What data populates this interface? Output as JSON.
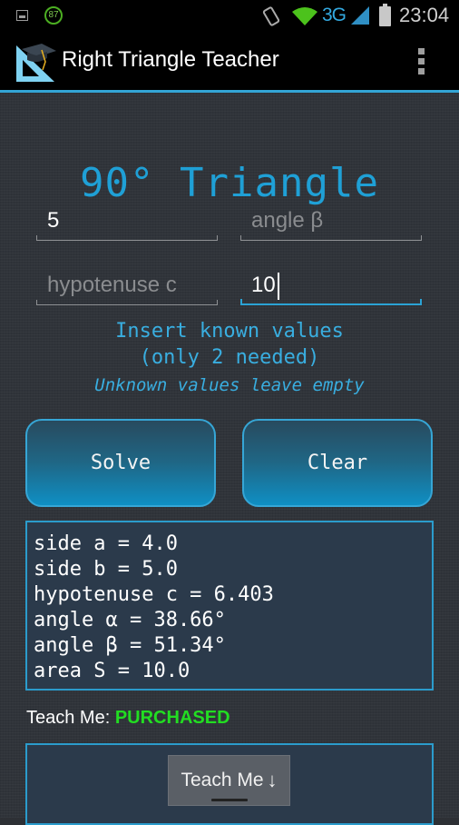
{
  "status_bar": {
    "battery_percent_badge": "87",
    "network": "3G",
    "time": "23:04",
    "icons": [
      "image-notification-icon",
      "battery-percent-icon",
      "vibrate-icon",
      "wifi-icon",
      "signal-icon",
      "battery-icon"
    ]
  },
  "action_bar": {
    "title": "Right Triangle Teacher",
    "menu_icon": "overflow-menu-icon"
  },
  "main": {
    "heading": "90° Triangle",
    "inputs": [
      {
        "name": "side-a",
        "value": "5",
        "placeholder": ""
      },
      {
        "name": "angle-beta",
        "value": "",
        "placeholder": "angle β"
      },
      {
        "name": "hypotenuse-c",
        "value": "",
        "placeholder": "hypotenuse c"
      },
      {
        "name": "area",
        "value": "10",
        "placeholder": ""
      }
    ],
    "hint_line1": "Insert known values",
    "hint_line2": "(only 2 needed)",
    "hint_line3": "Unknown values leave empty",
    "solve_label": "Solve",
    "clear_label": "Clear",
    "results": [
      "side a = 4.0",
      "side b = 5.0",
      "hypotenuse c = 6.403",
      "angle α = 38.66°",
      "angle β = 51.34°",
      "area S = 10.0"
    ],
    "teach_label": "Teach Me: ",
    "teach_status": "PURCHASED",
    "teach_button_label": "Teach Me",
    "teach_button_arrow": "↓"
  },
  "colors": {
    "accent": "#1fa0d6",
    "purchased": "#22dd22",
    "results_bg": "#2b3a4b"
  }
}
